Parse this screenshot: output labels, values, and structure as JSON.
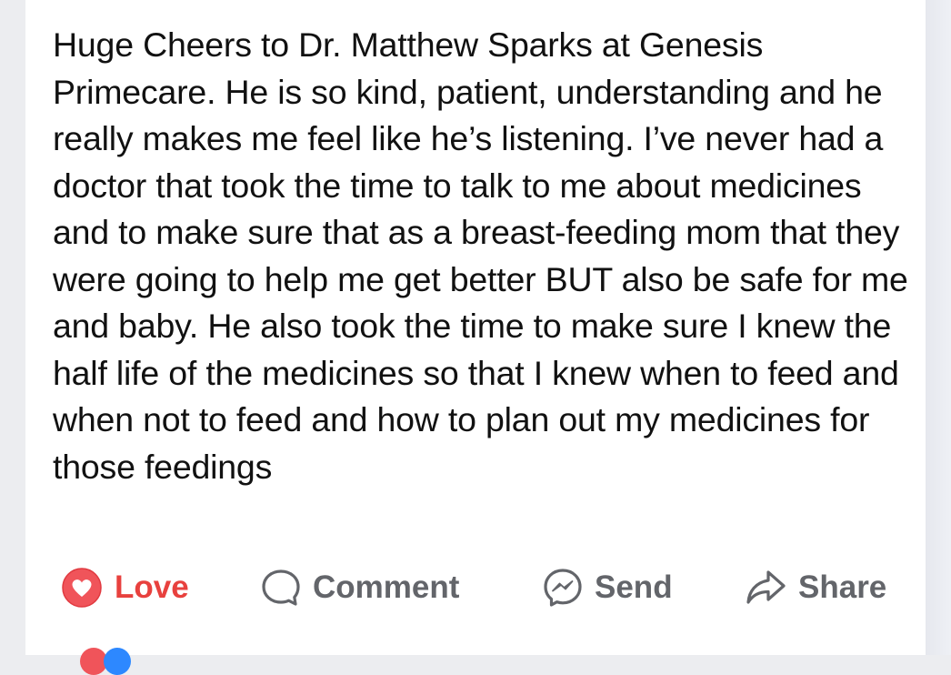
{
  "post": {
    "text": "Huge Cheers to Dr. Matthew Sparks at Genesis Primecare. He is so kind, patient, understanding and he really makes me feel like he’s listening. I’ve never had a doctor that took the time to talk to me about medicines and to make sure that as a breast-feeding mom that they were going to help me get better BUT also be safe for me and baby. He also took the time to make sure I knew the half life of the medicines so that I knew when to feed and when not to feed and how to plan out my medicines for those feedings"
  },
  "actions": {
    "love": {
      "label": "Love",
      "icon": "heart-reaction-icon",
      "color": "#e8413e"
    },
    "comment": {
      "label": "Comment",
      "icon": "comment-bubble-icon"
    },
    "send": {
      "label": "Send",
      "icon": "messenger-icon"
    },
    "share": {
      "label": "Share",
      "icon": "share-arrow-icon"
    }
  },
  "colors": {
    "text": "#111111",
    "action_gray": "#63656a",
    "love_red": "#e8413e",
    "background": "#ffffff"
  }
}
